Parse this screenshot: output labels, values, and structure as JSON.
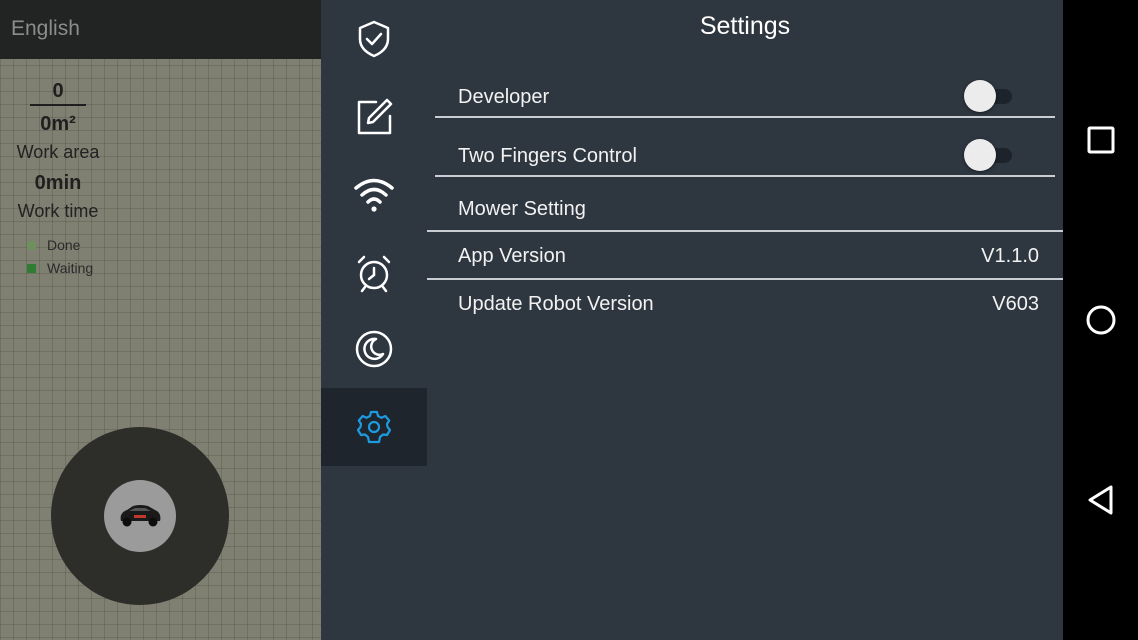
{
  "left_panel": {
    "language": "English",
    "count": "0",
    "work_area_value": "0m²",
    "work_area_label": "Work area",
    "work_time_value": "0min",
    "work_time_label": "Work time",
    "legend": [
      {
        "label": "Done",
        "color": "#6f8f5f"
      },
      {
        "label": "Waiting",
        "color": "#2e7d32"
      }
    ]
  },
  "icon_rail": {
    "items": [
      {
        "icon": "shield-check-icon",
        "active": false
      },
      {
        "icon": "edit-icon",
        "active": false
      },
      {
        "icon": "wifi-icon",
        "active": false
      },
      {
        "icon": "alarm-clock-icon",
        "active": false
      },
      {
        "icon": "moon-icon",
        "active": false
      },
      {
        "icon": "gear-icon",
        "active": true
      }
    ],
    "active_color": "#1e9be0"
  },
  "settings": {
    "title": "Settings",
    "developer_label": "Developer",
    "developer_on": false,
    "two_fingers_label": "Two Fingers Control",
    "two_fingers_on": false,
    "mower_setting_label": "Mower Setting",
    "app_version_label": "App Version",
    "app_version_value": "V1.1.0",
    "robot_version_label": "Update Robot Version",
    "robot_version_value": "V603"
  },
  "android_nav": {
    "items": [
      "recents-icon",
      "home-icon",
      "back-icon"
    ]
  }
}
